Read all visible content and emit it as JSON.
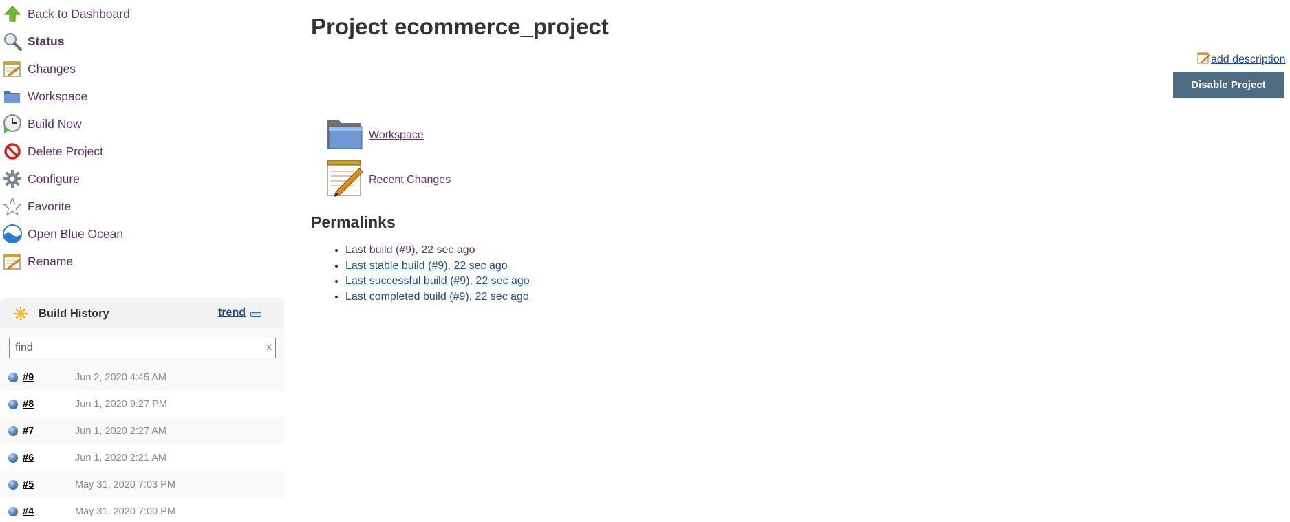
{
  "sidebar": {
    "tasks": [
      {
        "label": "Back to Dashboard",
        "icon": "up-arrow-icon"
      },
      {
        "label": "Status",
        "icon": "magnifier-icon"
      },
      {
        "label": "Changes",
        "icon": "notepad-icon"
      },
      {
        "label": "Workspace",
        "icon": "folder-icon"
      },
      {
        "label": "Build Now",
        "icon": "clock-icon"
      },
      {
        "label": "Delete Project",
        "icon": "no-entry-icon"
      },
      {
        "label": "Configure",
        "icon": "gear-icon"
      },
      {
        "label": "Favorite",
        "icon": "star-icon"
      },
      {
        "label": "Open Blue Ocean",
        "icon": "blue-ocean-icon"
      },
      {
        "label": "Rename",
        "icon": "notepad-icon"
      }
    ]
  },
  "build_history": {
    "title": "Build History",
    "trend_label": "trend",
    "find_value": "find",
    "clear_label": "x",
    "builds": [
      {
        "number": "#9",
        "date": "Jun 2, 2020 4:45 AM"
      },
      {
        "number": "#8",
        "date": "Jun 1, 2020 9:27 PM"
      },
      {
        "number": "#7",
        "date": "Jun 1, 2020 2:27 AM"
      },
      {
        "number": "#6",
        "date": "Jun 1, 2020 2:21 AM"
      },
      {
        "number": "#5",
        "date": "May 31, 2020 7:03 PM"
      },
      {
        "number": "#4",
        "date": "May 31, 2020 7:00 PM"
      }
    ]
  },
  "main": {
    "title": "Project ecommerce_project",
    "add_description": "add description",
    "disable_button": "Disable Project",
    "links": [
      {
        "label": "Workspace",
        "icon": "folder-icon"
      },
      {
        "label": "Recent Changes",
        "icon": "notepad-icon"
      }
    ],
    "permalinks_heading": "Permalinks",
    "permalinks": [
      {
        "label": "Last build (#9), 22 sec ago",
        "color": "#5c3566"
      },
      {
        "label": "Last stable build (#9), 22 sec ago",
        "color": "#204a87"
      },
      {
        "label": "Last successful build (#9), 22 sec ago",
        "color": "#204a87"
      },
      {
        "label": "Last completed build (#9), 22 sec ago",
        "color": "#204a87"
      }
    ]
  },
  "colors": {
    "link_visited": "#5c3566",
    "link": "#204a87",
    "button_bg": "#4d6c82"
  }
}
